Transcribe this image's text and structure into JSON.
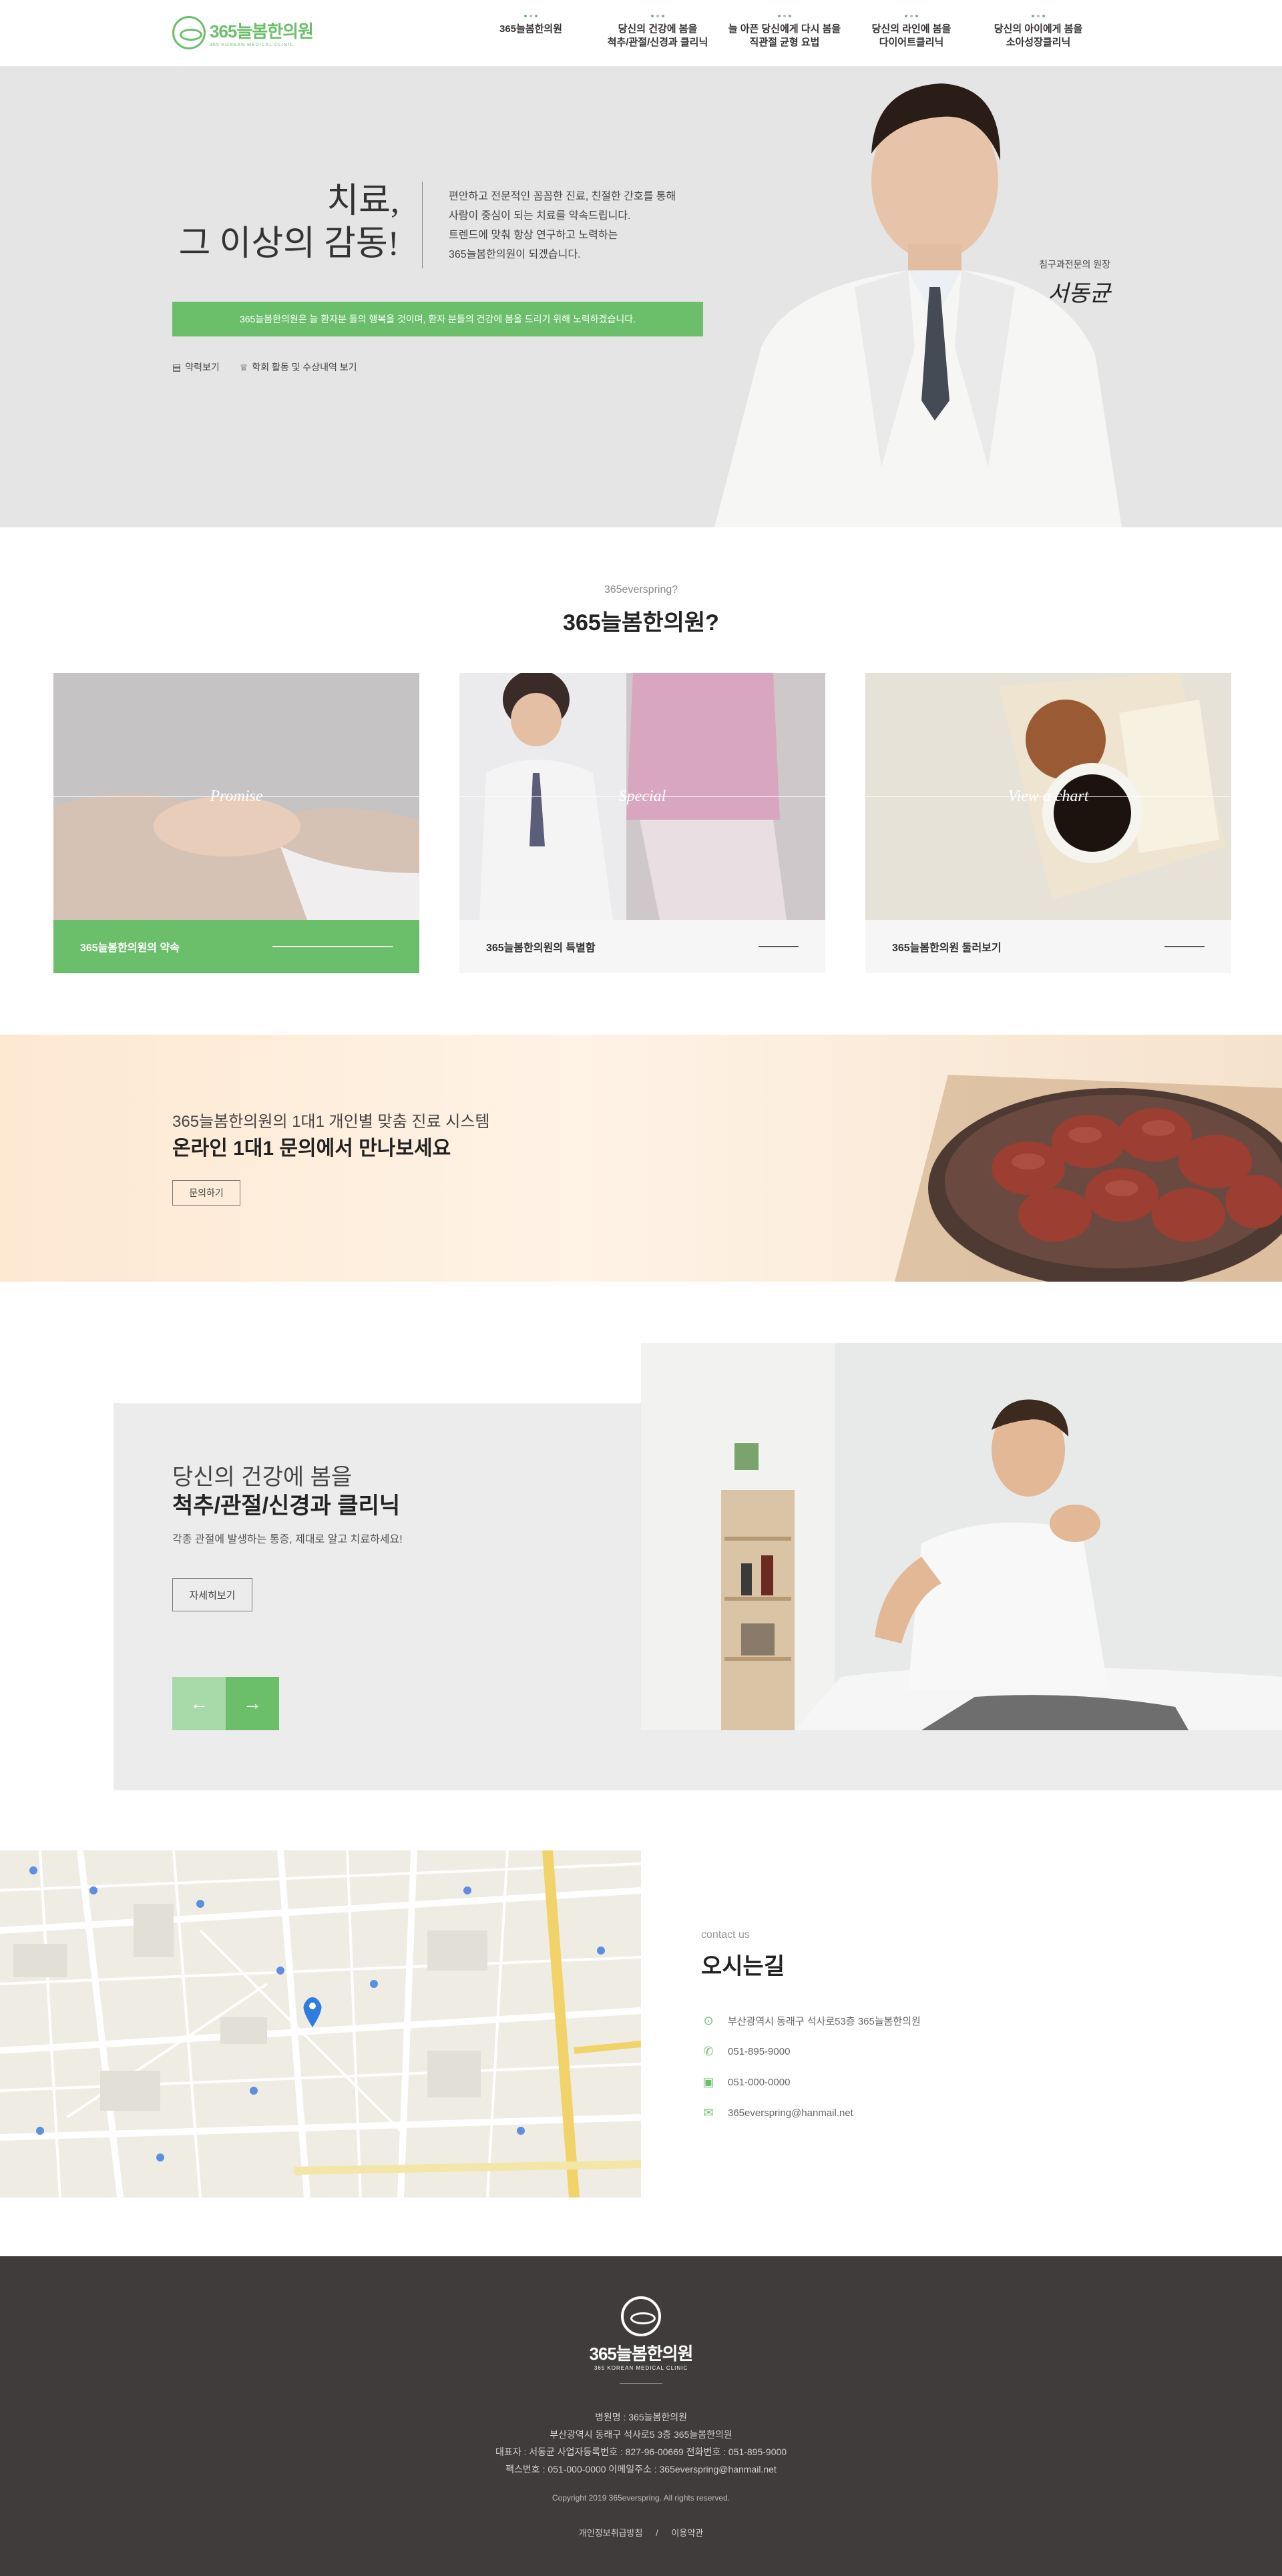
{
  "header": {
    "logo_name": "365늘봄한의원",
    "logo_sub": "365 KOREAN MEDICAL CLINIC",
    "nav": [
      {
        "line1": "365늘봄한의원",
        "line2": ""
      },
      {
        "line1": "당신의 건강에 봄을",
        "line2": "척추/관절/신경과 클리닉"
      },
      {
        "line1": "늘 아픈 당신에게 다시 봄을",
        "line2": "직관절 균형 요법"
      },
      {
        "line1": "당신의 라인에 봄을",
        "line2": "다이어트클리닉"
      },
      {
        "line1": "당신의 아이에게 봄을",
        "line2": "소아성장클리닉"
      }
    ]
  },
  "hero": {
    "title_line1": "치료,",
    "title_line2": "그 이상의 감동!",
    "desc": [
      "편안하고 전문적인 꼼꼼한 진료, 친절한 간호를 통해",
      "사람이 중심이 되는 치료를 약속드립니다.",
      "트렌드에 맞춰 항상 연구하고 노력하는",
      "365늘봄한의원이 되겠습니다."
    ],
    "bar_text": "365늘봄한의원은 늘 환자분 들의 행복을 것이며, 환자 분들의 건강에 봄을 드리기 위해 노력하겠습니다.",
    "link_1": "약력보기",
    "link_2": "학회 활동 및 수상내역 보기",
    "doctor_role": "침구과전문의 원장",
    "doctor_name": "서동균"
  },
  "intro": {
    "sub": "365everspring?",
    "title": "365늘봄한의원?"
  },
  "cards": [
    {
      "overlay": "Promise",
      "label": "365늘봄한의원의 약속"
    },
    {
      "overlay": "Special",
      "label": "365늘봄한의원의 특별함"
    },
    {
      "overlay": "View a chart",
      "label": "365늘봄한의원 둘러보기"
    }
  ],
  "banner": {
    "sub": "365늘봄한의원의 1대1 개인별 맞춤 진료 시스템",
    "title": "온라인 1대1 문의에서 만나보세요",
    "button": "문의하기"
  },
  "feature": {
    "title1": "당신의 건강에 봄을",
    "title2": "척추/관절/신경과 클리닉",
    "desc": "각종 관절에 발생하는 통증, 제대로 알고 치료하세요!",
    "button": "자세히보기",
    "prev": "←",
    "next": "→"
  },
  "location": {
    "sub": "contact us",
    "title": "오시는길",
    "items": [
      {
        "icon": "pin-icon",
        "text": "부산광역시 동래구 석사로53층 365늘봄한의원"
      },
      {
        "icon": "phone-icon",
        "text": "051-895-9000"
      },
      {
        "icon": "fax-icon",
        "text": "051-000-0000"
      },
      {
        "icon": "mail-icon",
        "text": "365everspring@hanmail.net"
      }
    ]
  },
  "footer": {
    "name": "365늘봄한의원",
    "en": "365 KOREAN MEDICAL CLINIC",
    "info": [
      "병원명 : 365늘봄한의원",
      "부산광역시 동래구 석사로5 3층 365늘봄한의원",
      "대표자 : 서동균    사업자등록번호 : 827-96-00669    전화번호 : 051-895-9000",
      "팩스번호 : 051-000-0000    이메일주소 : 365everspring@hanmail.net"
    ],
    "copyright": "Copyright 2019 365everspring. All rights reserved.",
    "link_privacy": "개인정보취급방침",
    "link_sep": "/",
    "link_terms": "이용약관"
  },
  "colors": {
    "accent": "#6bbf6b",
    "footer_bg": "#403c3c",
    "hero_bg": "#e5e5e5"
  }
}
